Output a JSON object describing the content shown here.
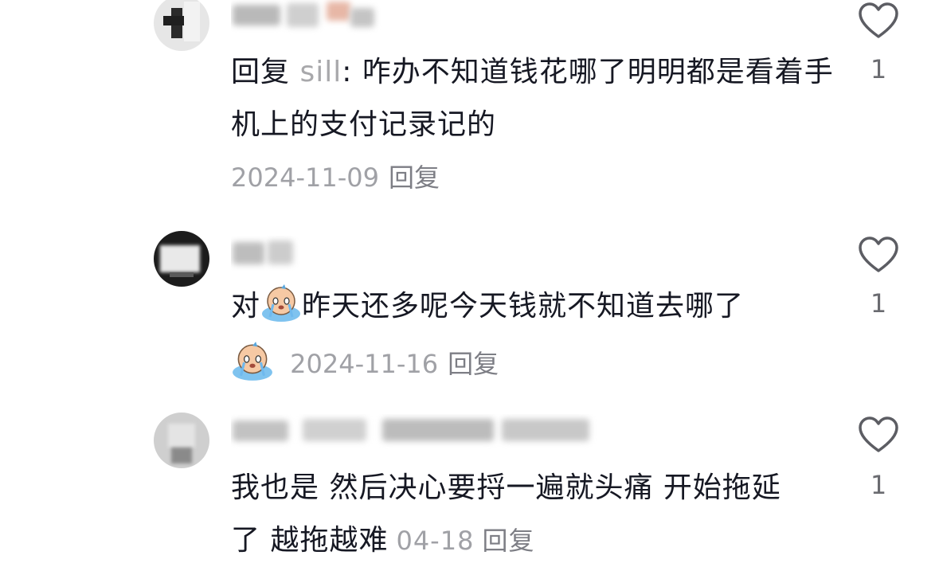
{
  "comments": [
    {
      "username": "",
      "text_prefix": "回复 ",
      "mention": "sill",
      "text": ": 咋办不知道钱花哪了明明都是看着手机上的支付记录记的",
      "date": "2024-11-09",
      "reply_label": "回复",
      "likes": "1",
      "avatar_icon": "avatar-icon"
    },
    {
      "username": "",
      "text_before_emoji": "对",
      "emoji": "crying-face-emoji",
      "text_after_emoji": "昨天还多呢今天钱就不知道去哪了",
      "date": "2024-11-16",
      "reply_label": "回复",
      "likes": "1",
      "avatar_icon": "avatar-icon"
    },
    {
      "username": "",
      "text": "我也是 然后决心要捋一遍就头痛 开始拖延了 越拖越难",
      "date": "04-18",
      "reply_label": "回复",
      "likes": "1",
      "avatar_icon": "avatar-icon"
    }
  ],
  "colors": {
    "text": "#161823",
    "meta": "#a0a1a6",
    "mention": "#a8a8ab",
    "heart_stroke": "#5c5d63"
  }
}
